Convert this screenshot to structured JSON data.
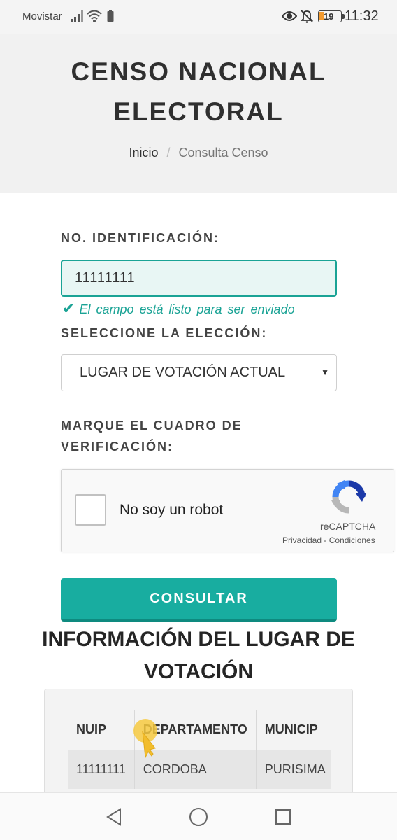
{
  "status_bar": {
    "carrier": "Movistar",
    "battery_level": "19",
    "time": "11:32"
  },
  "header": {
    "title": "CENSO NACIONAL ELECTORAL",
    "breadcrumb": {
      "home": "Inicio",
      "separator": "/",
      "current": "Consulta Censo"
    }
  },
  "form": {
    "id_label": "NO. IDENTIFICACIÓN:",
    "id_value": "11111111",
    "valid_check": "✔",
    "valid_message": "El campo está listo para ser enviado",
    "election_label": "SELECCIONE LA ELECCIÓN:",
    "election_selected": "LUGAR DE VOTACIÓN ACTUAL",
    "captcha_label": "MARQUE EL CUADRO DE VERIFICACIÓN:",
    "captcha": {
      "text": "No soy un robot",
      "brand": "reCAPTCHA",
      "links": "Privacidad - Condiciones",
      "checked": false
    },
    "submit_label": "CONSULTAR"
  },
  "result": {
    "title": "INFORMACIÓN DEL LUGAR DE VOTACIÓN",
    "columns": [
      "NUIP",
      "DEPARTAMENTO",
      "MUNICIP"
    ],
    "rows": [
      [
        "11111111",
        "CORDOBA",
        "PURISIMA"
      ]
    ]
  },
  "colors": {
    "accent": "#18ada0",
    "valid_input_bg": "#e8f6f4",
    "header_bg": "#f1f1f1"
  },
  "icons": {
    "status": [
      "signal-icon",
      "wifi-icon",
      "battery-saver-icon",
      "eye-icon",
      "bell-off-icon",
      "battery-icon"
    ],
    "nav": [
      "back-icon",
      "home-icon",
      "recent-apps-icon"
    ],
    "captcha": "recaptcha-logo-icon",
    "select": "dropdown-arrow-icon"
  }
}
